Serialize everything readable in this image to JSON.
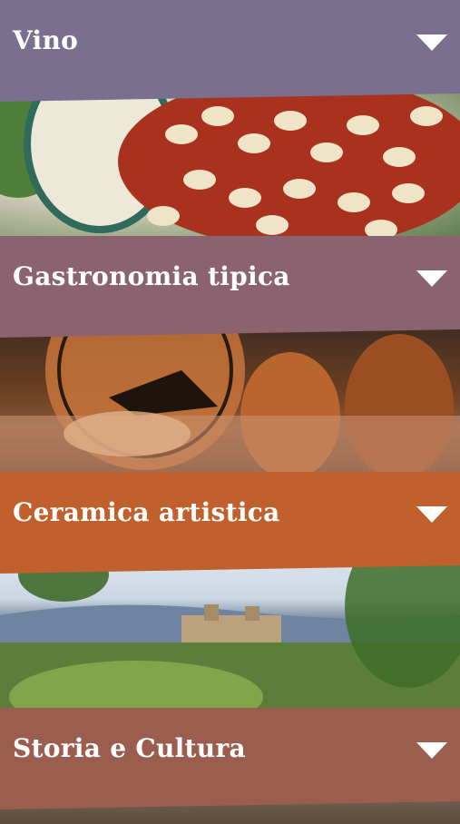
{
  "sections": [
    {
      "label": "Vino",
      "color": "#7b6f8f"
    },
    {
      "label": "Gastronomia tipica",
      "color": "#8b6270"
    },
    {
      "label": "Ceramica artistica",
      "color": "#c0602c"
    },
    {
      "label": "Storia e Cultura",
      "color": "#9b5d4e"
    }
  ],
  "icons": {
    "expand": "chevron-down-icon"
  }
}
